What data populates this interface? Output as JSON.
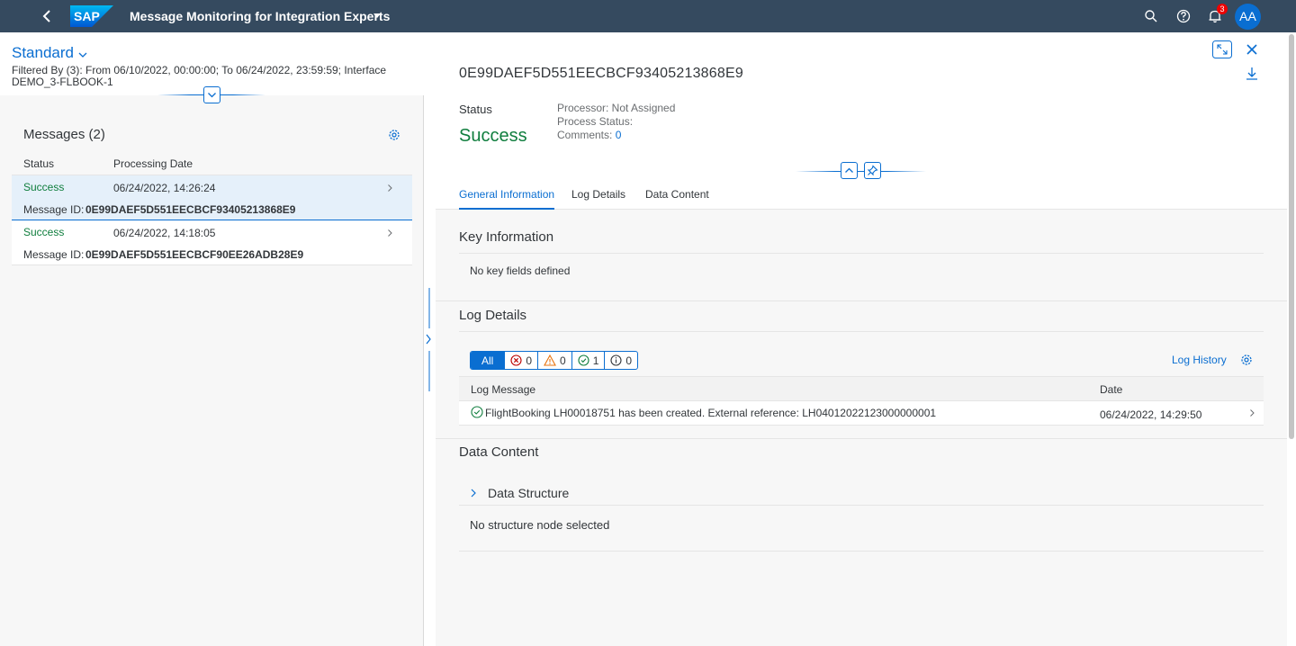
{
  "shell": {
    "logo_text": "SAP",
    "title": "Message Monitoring for Integration Experts",
    "notification_count": "3",
    "avatar_initials": "AA",
    "icons": [
      "back-arrow-icon",
      "search-icon",
      "help-icon",
      "bell-icon"
    ]
  },
  "master": {
    "variant": "Standard",
    "filtered_by": "Filtered By (3): From 06/10/2022, 00:00:00; To 06/24/2022, 23:59:59; Interface DEMO_3-FLBOOK-1",
    "messages_title": "Messages (2)",
    "columns": {
      "status": "Status",
      "processing_date": "Processing Date"
    },
    "message_id_label": "Message ID:",
    "rows": [
      {
        "status": "Success",
        "date": "06/24/2022, 14:26:24",
        "message_id": "0E99DAEF5D551EECBCF93405213868E9",
        "selected": true
      },
      {
        "status": "Success",
        "date": "06/24/2022, 14:18:05",
        "message_id": "0E99DAEF5D551EECBCF90EE26ADB28E9",
        "selected": false
      }
    ]
  },
  "detail": {
    "title": "0E99DAEF5D551EECBCF93405213868E9",
    "status_label": "Status",
    "status_value": "Success",
    "processor": "Processor: Not Assigned",
    "process_status": "Process Status:",
    "comments_label": "Comments:",
    "comments_count": "0",
    "tabs": [
      "General Information",
      "Log Details",
      "Data Content"
    ],
    "key_info": {
      "title": "Key Information",
      "text": "No key fields defined"
    },
    "log_details": {
      "title": "Log Details",
      "filter": {
        "all": "All",
        "error": "0",
        "warning": "0",
        "success": "1",
        "info": "0"
      },
      "log_history": "Log History",
      "columns": {
        "message": "Log Message",
        "date": "Date"
      },
      "rows": [
        {
          "message": "FlightBooking LH00018751 has been created. External reference: LH04012022123000000001",
          "date": "06/24/2022, 14:29:50"
        }
      ]
    },
    "data_content": {
      "title": "Data Content",
      "structure_title": "Data Structure",
      "empty_text": "No structure node selected"
    }
  },
  "colors": {
    "shell_bg": "#354a5f",
    "accent": "#0a6ed1",
    "success": "#107e3e",
    "error": "#bb0000",
    "warning": "#e9730c"
  }
}
